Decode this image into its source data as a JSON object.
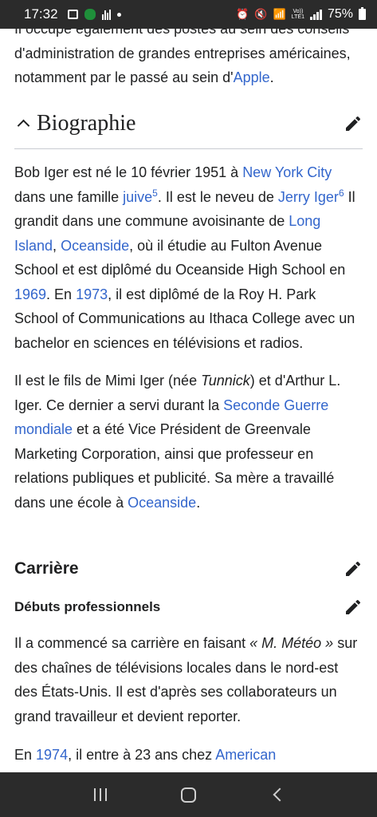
{
  "status_bar": {
    "time": "17:32",
    "battery": "75%",
    "network_tag_top": "Vo))",
    "network_tag_bottom": "LTE1"
  },
  "article": {
    "intro_tail": {
      "line1": "Il occupe également des postes au sein des conseils",
      "line2": "d'administration de grandes entreprises américaines,",
      "line3_pre": "notamment par le passé au sein d'",
      "line3_link": "Apple",
      "line3_post": "."
    },
    "section_biographie": {
      "title": "Biographie",
      "p1": {
        "t1": "Bob Iger est né le 10 février 1951 à ",
        "l1": "New York City",
        "t2": "dans une famille ",
        "l2": "juive",
        "s1": "5",
        "t3": ". Il est le neveu de ",
        "l3": "Jerry Iger",
        "s2": "6",
        "t4": " Il",
        "t5": "grandit dans une commune avoisinante de ",
        "l4": "Long",
        "l5": "Island",
        "t6": ", ",
        "l6": "Oceanside",
        "t7": ", où il étudie au Fulton Avenue",
        "t8": "School et est diplômé du Oceanside High School en",
        "l7": "1969",
        "t9": ". En ",
        "l8": "1973",
        "t10": ", il est diplômé de la Roy H. Park",
        "t11": "School of Communications au Ithaca College avec un",
        "t12": "bachelor en sciences en télévisions et radios."
      },
      "p2": {
        "t1": "Il est le fils de Mimi Iger (née ",
        "i1": "Tunnick",
        "t2": ") et d'Arthur L.",
        "t3": "Iger. Ce dernier a servi durant la ",
        "l1": "Seconde Guerre",
        "l2": "mondiale",
        "t4": " et a été Vice Président de Greenvale",
        "t5": "Marketing Corporation, ainsi que professeur en",
        "t6": "relations publiques et publicité. Sa mère a travaillé",
        "t7": "dans une école à ",
        "l3": "Oceanside",
        "t8": "."
      }
    },
    "section_carriere": {
      "title": "Carrière",
      "subsection_title": "Débuts professionnels",
      "p1": {
        "t1": "Il a commencé sa carrière en faisant ",
        "i1": "« M. Météo »",
        "t2": " sur",
        "t3": "des chaînes de télévisions locales dans le nord-est",
        "t4": "des États-Unis. Il est d'après ses collaborateurs un",
        "t5": "grand travailleur et devient reporter."
      },
      "p2": {
        "t1": "En ",
        "l1": "1974",
        "t2": ", il entre à 23 ans chez ",
        "l2": "American"
      }
    }
  },
  "colors": {
    "link": "#3366cc",
    "text": "#202122",
    "system_bars": "#2b2b2b"
  }
}
